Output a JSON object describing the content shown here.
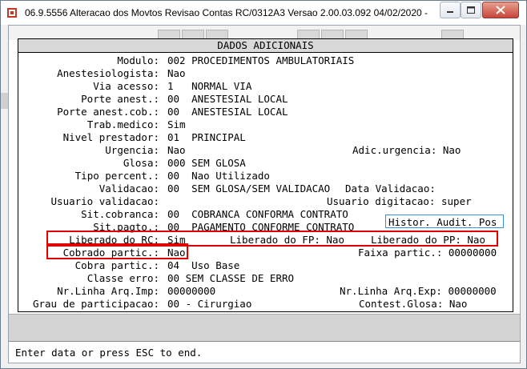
{
  "window": {
    "title": "06.9.5556  Alteracao  dos Movtos Revisao Contas RC/0312A3 Versao 2.00.03.092 04/02/2020 -",
    "minimize_label": "",
    "maximize_label": "",
    "close_label": ""
  },
  "dialog": {
    "title": "DADOS ADICIONAIS",
    "fields": [
      {
        "label": "Modulo:",
        "value": "002 PROCEDIMENTOS AMBULATORIAIS"
      },
      {
        "label": "Anestesiologista:",
        "value": "Nao"
      },
      {
        "label": "Via acesso:",
        "value": "1   NORMAL VIA"
      },
      {
        "label": "Porte anest.:",
        "value": "00  ANESTESIAL LOCAL"
      },
      {
        "label": "Porte anest.cob.:",
        "value": "00  ANESTESIAL LOCAL"
      },
      {
        "label": "Trab.medico:",
        "value": "Sim"
      },
      {
        "label": "Nivel prestador:",
        "value": "01  PRINCIPAL"
      },
      {
        "label": "Urgencia:",
        "value": "Nao"
      },
      {
        "label": "Glosa:",
        "value": "000 SEM GLOSA"
      },
      {
        "label": "Tipo percent.:",
        "value": "00  Nao Utilizado"
      },
      {
        "label": "Validacao:",
        "value": "00  SEM GLOSA/SEM VALIDACAO"
      },
      {
        "label": "Usuario validacao:",
        "value": ""
      },
      {
        "label": "Sit.cobranca:",
        "value": "00  COBRANCA CONFORMA CONTRATO"
      },
      {
        "label": "Sit.pagto.:",
        "value": "00  PAGAMENTO CONFORME CONTRATO"
      },
      {
        "label": "Liberado do RC:",
        "value": "Sim"
      },
      {
        "label": "Cobrado partic.:",
        "value": "Nao"
      },
      {
        "label": "Cobra partic.:",
        "value": "04  Uso Base"
      },
      {
        "label": "Classe erro:",
        "value": "00 SEM CLASSE DE ERRO"
      },
      {
        "label": "Nr.Linha Arq.Imp:",
        "value": "00000000"
      },
      {
        "label": "Grau de participacao:",
        "value": "00 - Cirurgiao"
      }
    ],
    "right_fields": {
      "adic_urgencia": "Adic.urgencia: Nao",
      "data_validacao": "Data Validacao:",
      "usuario_digitacao": "Usuario digitacao: super",
      "liberado_fp": "Liberado do FP: Nao",
      "liberado_pp": "Liberado do PP: Nao",
      "faixa_partic": "Faixa partic.: 00000000",
      "nr_linha_exp": "Nr.Linha Arq.Exp: 00000000",
      "contest_glosa": "Contest.Glosa: Nao"
    },
    "histor_button": "Histor. Audit. Pos"
  },
  "status": {
    "message": "Enter data or press ESC to end."
  },
  "colors": {
    "highlight": "#e00000",
    "button_border": "#3a8fd6"
  }
}
